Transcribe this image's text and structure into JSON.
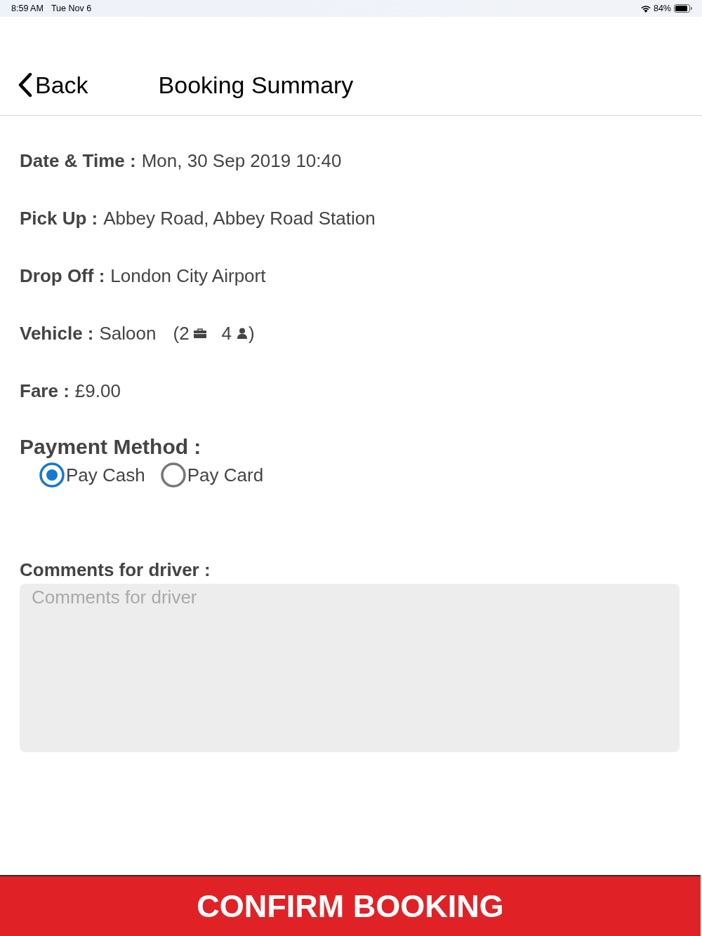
{
  "status_bar": {
    "time": "8:59 AM",
    "date": "Tue Nov 6",
    "battery": "84%"
  },
  "nav_bar": {
    "back": "Back",
    "title": "Booking Summary"
  },
  "details": [
    {
      "kind": "text",
      "label": "Date & Time :",
      "value": "Mon, 30 Sep 2019 10:40"
    },
    {
      "kind": "text",
      "label": "Pick Up :",
      "value": "Abbey Road, Abbey Road Station"
    },
    {
      "kind": "text",
      "label": "Drop Off :",
      "value": "London City Airport"
    },
    {
      "kind": "vehicle",
      "label": "Vehicle :",
      "value": "Saloon",
      "luggage": "(2",
      "passengers": "4",
      "suffix": ")"
    },
    {
      "kind": "text",
      "label": "Fare :",
      "value": "£9.00"
    }
  ],
  "payment": {
    "title": "Payment Method :",
    "options": [
      {
        "label": "Pay Cash",
        "selected": true
      },
      {
        "label": "Pay Card",
        "selected": false
      }
    ]
  },
  "comments": {
    "label": "Comments for driver :",
    "placeholder": "Comments for driver"
  },
  "confirm_button": "CONFIRM BOOKING"
}
